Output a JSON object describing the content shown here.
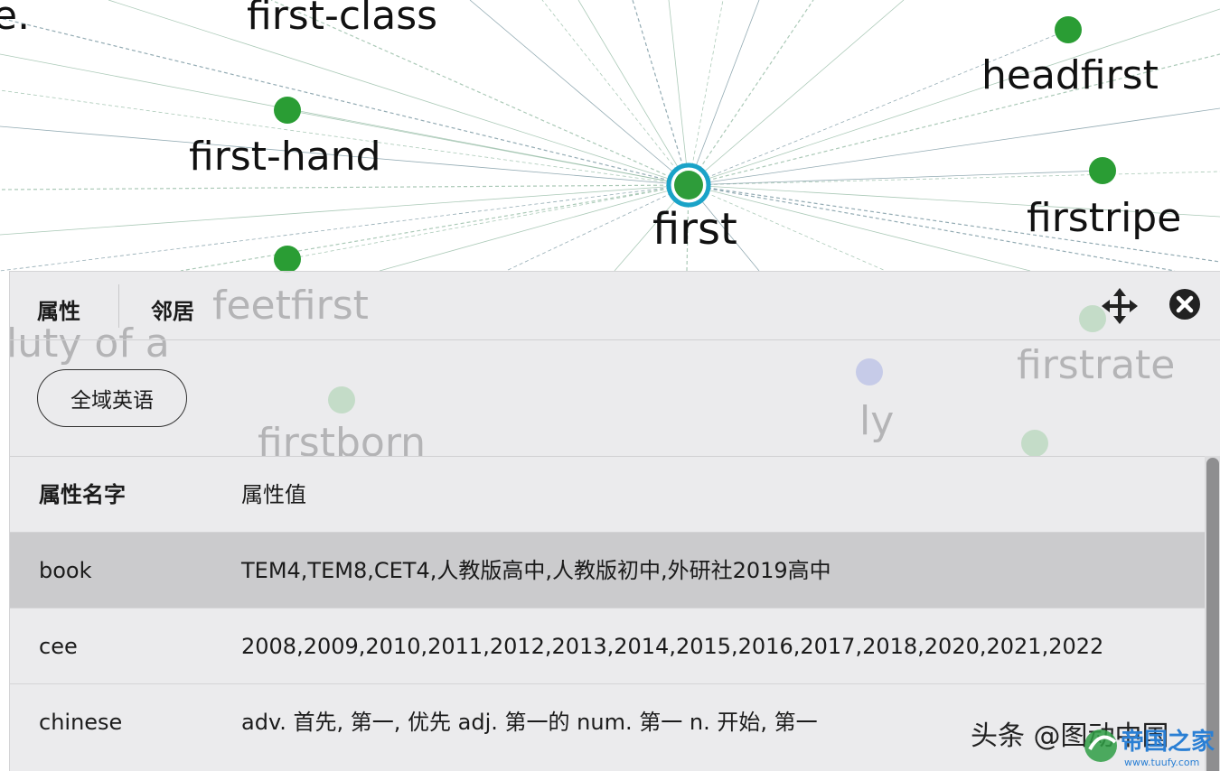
{
  "graph": {
    "center": {
      "label": "first",
      "ring_color": "#1aa3c8",
      "fill_color": "#2e9c3a"
    },
    "nodes": [
      {
        "label": "first-class"
      },
      {
        "label": "headfirst"
      },
      {
        "label": "first-hand"
      },
      {
        "label": "firstripe"
      },
      {
        "label": "feetfirst"
      },
      {
        "label": "firstrate"
      },
      {
        "label": "firstborn"
      },
      {
        "label": "ly"
      },
      {
        "label": "luty of a"
      },
      {
        "label": "e."
      },
      {
        "label": ""
      }
    ],
    "node_color": "#2a9d34",
    "faded_node_color": "#7fc28a",
    "alt_node_color": "#9aa8e8",
    "edge_color": "#8fb8a0"
  },
  "panel": {
    "tabs": [
      {
        "label": "属性"
      },
      {
        "label": "邻居"
      }
    ],
    "scope_button_label": "全域英语",
    "table": {
      "headers": {
        "key": "属性名字",
        "value": "属性值"
      },
      "rows": [
        {
          "key": "book",
          "value": "TEM4,TEM8,CET4,人教版高中,人教版初中,外研社2019高中",
          "selected": true
        },
        {
          "key": "cee",
          "value": "2008,2009,2010,2011,2012,2013,2014,2015,2016,2017,2018,2020,2021,2022",
          "selected": false
        },
        {
          "key": "chinese",
          "value": "adv. 首先, 第一, 优先 adj. 第一的 num. 第一 n. 开始, 第一",
          "selected": false
        }
      ]
    }
  },
  "watermark": {
    "text": "头条 @图动中国",
    "logo_text": "帝国之家",
    "logo_url_text": "www.tuufy.com"
  }
}
